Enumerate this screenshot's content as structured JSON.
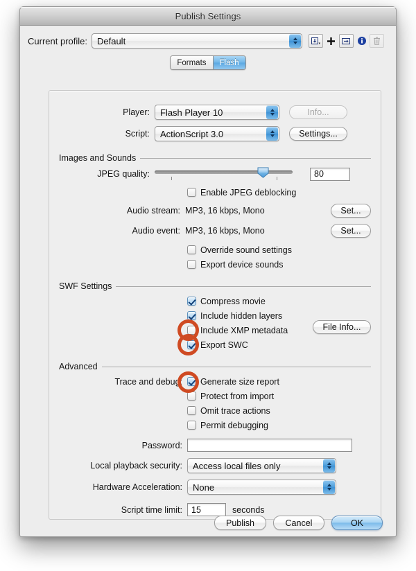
{
  "window": {
    "title": "Publish Settings"
  },
  "profile": {
    "label": "Current profile:",
    "value": "Default",
    "tools": [
      {
        "name": "import-profile-icon",
        "title": "Import profile"
      },
      {
        "name": "add-profile-icon",
        "title": "Create new profile"
      },
      {
        "name": "duplicate-profile-icon",
        "title": "Duplicate profile"
      },
      {
        "name": "profile-properties-icon",
        "title": "Profile properties"
      },
      {
        "name": "delete-profile-icon",
        "title": "Delete profile"
      }
    ]
  },
  "tabs": [
    {
      "label": "Formats",
      "active": false
    },
    {
      "label": "Flash",
      "active": true
    }
  ],
  "player": {
    "label": "Player:",
    "value": "Flash Player 10",
    "button": "Info...",
    "button_disabled": true
  },
  "script": {
    "label": "Script:",
    "value": "ActionScript 3.0",
    "button": "Settings...",
    "button_disabled": false
  },
  "images_and_sounds": {
    "title": "Images and Sounds",
    "jpeg_quality": {
      "label": "JPEG quality:",
      "value": "80",
      "slider_percent": 80
    },
    "enable_jpeg_deblocking": {
      "label": "Enable JPEG deblocking",
      "checked": false
    },
    "audio_stream": {
      "label": "Audio stream:",
      "value": "MP3, 16 kbps, Mono",
      "button": "Set..."
    },
    "audio_event": {
      "label": "Audio event:",
      "value": "MP3, 16 kbps, Mono",
      "button": "Set..."
    },
    "override_sound_settings": {
      "label": "Override sound settings",
      "checked": false
    },
    "export_device_sounds": {
      "label": "Export device sounds",
      "checked": false
    }
  },
  "swf_settings": {
    "title": "SWF Settings",
    "compress_movie": {
      "label": "Compress movie",
      "checked": true
    },
    "include_hidden_layers": {
      "label": "Include hidden layers",
      "checked": true
    },
    "include_xmp_metadata": {
      "label": "Include XMP metadata",
      "checked": false,
      "highlighted": true
    },
    "export_swc": {
      "label": "Export SWC",
      "checked": true,
      "highlighted": true
    },
    "file_info_button": "File Info..."
  },
  "advanced": {
    "title": "Advanced",
    "trace_and_debug_label": "Trace and debug:",
    "generate_size_report": {
      "label": "Generate size report",
      "checked": true,
      "highlighted": true
    },
    "protect_from_import": {
      "label": "Protect from import",
      "checked": false
    },
    "omit_trace_actions": {
      "label": "Omit trace actions",
      "checked": false
    },
    "permit_debugging": {
      "label": "Permit debugging",
      "checked": false
    },
    "password": {
      "label": "Password:",
      "value": "",
      "placeholder": ""
    },
    "local_playback_security": {
      "label": "Local playback security:",
      "value": "Access local files only"
    },
    "hardware_acceleration": {
      "label": "Hardware Acceleration:",
      "value": "None"
    },
    "script_time_limit": {
      "label": "Script time limit:",
      "value": "15",
      "unit": "seconds"
    }
  },
  "footer": {
    "publish": "Publish",
    "cancel": "Cancel",
    "ok": "OK"
  },
  "colors": {
    "annotation_ring": "#cf4a22",
    "accent_blue": "#5aa8e2",
    "window_bg": "#ededed",
    "panel_bg": "#eeeeee"
  }
}
